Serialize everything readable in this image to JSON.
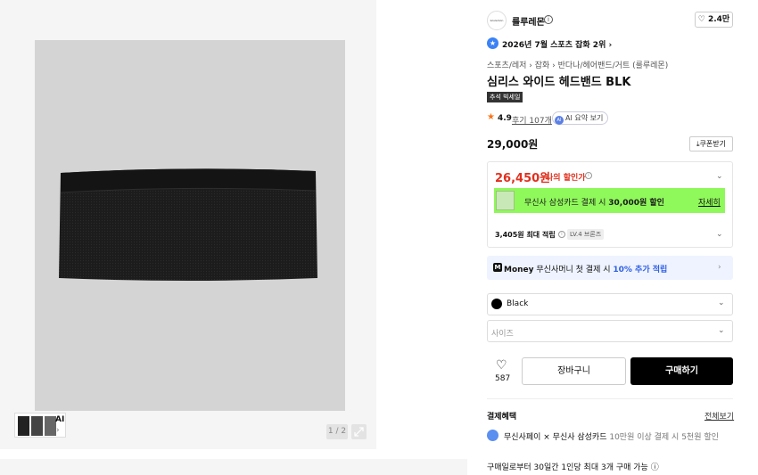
{
  "gallery": {
    "thumb_ai_label": "AI",
    "page_counter": "1 / 2"
  },
  "brand": {
    "logo_text": "lululemon",
    "name": "룰루레몬",
    "info_icon": "info-icon",
    "like_count": "♡ 2.4만"
  },
  "rank": {
    "text": "2026년 7월 스포츠 잡화 2위 ›"
  },
  "breadcrumb": "스포츠/레저 › 잡화 › 반다나/헤어밴드/거트 (룰루레몬)",
  "product": {
    "title": "심리스 와이드 헤드밴드 BLK",
    "tag": "추석 빅세일",
    "rating": "4.9",
    "reviews": "후기 107개",
    "ai_summary_icon": "AI",
    "ai_summary": "AI 요약 보기",
    "price": "29,000원",
    "coupon_button": "쿠폰받기"
  },
  "discount": {
    "sale_price": "26,450원",
    "my_discount_label": "나의 할인가",
    "card_text_prefix": "무신사 삼성카드 결제 시 ",
    "card_text_amount": "30,000원 할인",
    "card_detail": "자세히",
    "points": "3,405원 최대 적립",
    "level_badge": "LV.4 브론즈"
  },
  "money": {
    "logo_text": "Money",
    "text_prefix": "무신사머니 첫 결제 시 ",
    "text_highlight": "10% 추가 적립"
  },
  "options": {
    "color": "Black",
    "size_placeholder": "사이즈"
  },
  "actions": {
    "wish_count": "587",
    "cart": "장바구니",
    "buy": "구매하기"
  },
  "benefits": {
    "title": "결제혜택",
    "view_all": "전체보기",
    "line_main": "무신사페이 × 무신사 삼성카드",
    "line_grey": " 10만원 이상 결제 시 5천원 할인",
    "purchase_limit": "구매일로부터 30일간 1인당 최대 3개 구매 가능 ⓘ"
  },
  "colors": {
    "accent_red": "#e0301e",
    "card_banner": "#8ff85a",
    "money_blue": "#2f5fe3"
  }
}
